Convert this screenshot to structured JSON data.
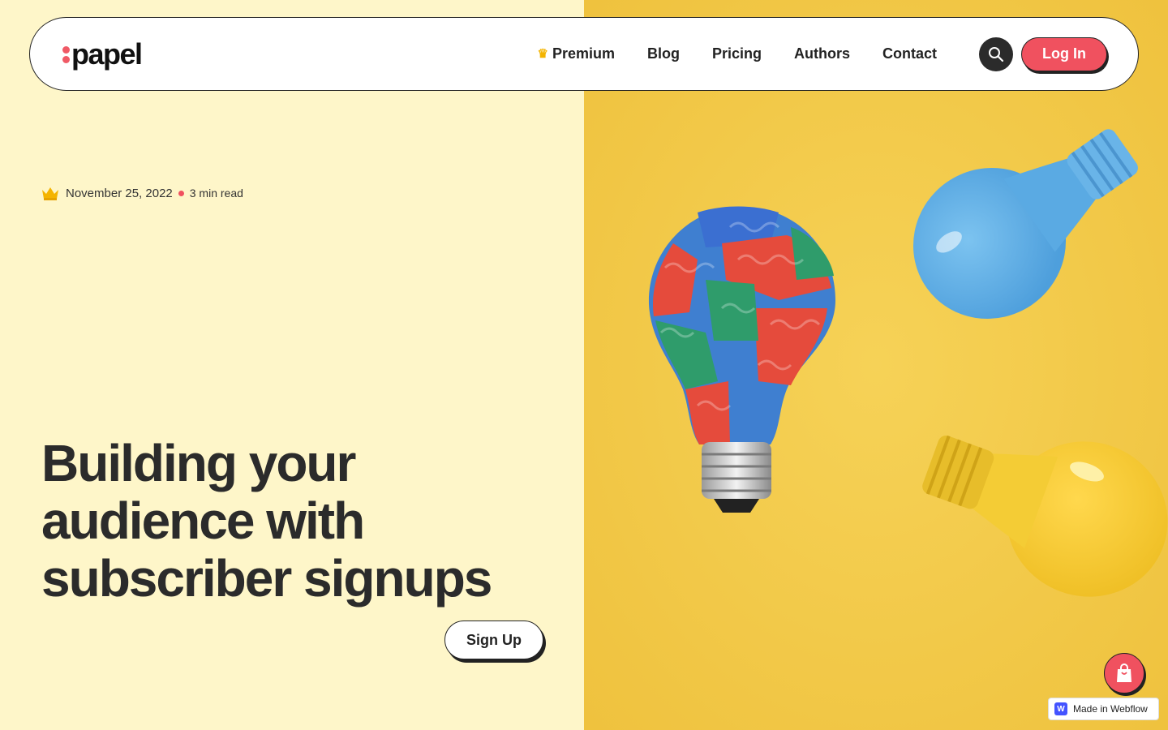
{
  "brand": {
    "name": "papel",
    "accent": "#f0515f"
  },
  "nav": {
    "items": [
      {
        "label": "Premium",
        "icon": "crown-icon"
      },
      {
        "label": "Blog"
      },
      {
        "label": "Pricing"
      },
      {
        "label": "Authors"
      },
      {
        "label": "Contact"
      }
    ],
    "search_icon": "search-icon",
    "login_label": "Log In"
  },
  "post": {
    "date": "November 25, 2022",
    "read_time": "3 min read",
    "title": "Building your audience with subscriber signups"
  },
  "cta": {
    "signup_label": "Sign Up"
  },
  "cart": {
    "icon": "shopping-bag-icon"
  },
  "badge": {
    "label": "Made in Webflow",
    "logo_letter": "W"
  },
  "colors": {
    "left_bg": "#fef6c9",
    "right_bg": "#f2c94c",
    "dark": "#222222"
  }
}
